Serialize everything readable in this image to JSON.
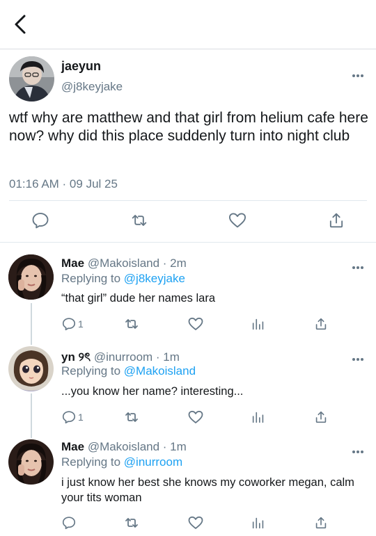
{
  "main_tweet": {
    "display_name": "jaeyun",
    "handle": "@j8keyjake",
    "text": "wtf why are matthew and that girl from helium cafe here now? why did this place suddenly turn into night club",
    "timestamp": "01:16 AM · 09 Jul 25"
  },
  "replies": [
    {
      "display_name": "Mae",
      "meta": "@Makoisland · 2m",
      "replying_prefix": "Replying to ",
      "replying_to": "@j8keyjake",
      "text": "“that girl” dude her names lara",
      "reply_count": "1"
    },
    {
      "display_name": "yn ୨ৎ",
      "meta": "@inurroom · 1m",
      "replying_prefix": "Replying to ",
      "replying_to": "@Makoisland",
      "text": "...you know her name? interesting...",
      "reply_count": "1"
    },
    {
      "display_name": "Mae",
      "meta": "@Makoisland · 1m",
      "replying_prefix": "Replying to ",
      "replying_to": "@inurroom",
      "text": "i just know her best she knows my coworker megan, calm your tits woman",
      "reply_count": ""
    }
  ],
  "colors": {
    "text": "#14171a",
    "secondary": "#657786",
    "link": "#1da1f2",
    "divider": "#e1e8ed",
    "thread_line": "#cfd9de"
  },
  "icons": {
    "back": "chevron-left-icon",
    "more": "more-horizontal-icon",
    "reply": "speech-bubble-icon",
    "retweet": "retweet-icon",
    "like": "heart-icon",
    "analytics": "bar-chart-icon",
    "share": "share-icon"
  }
}
